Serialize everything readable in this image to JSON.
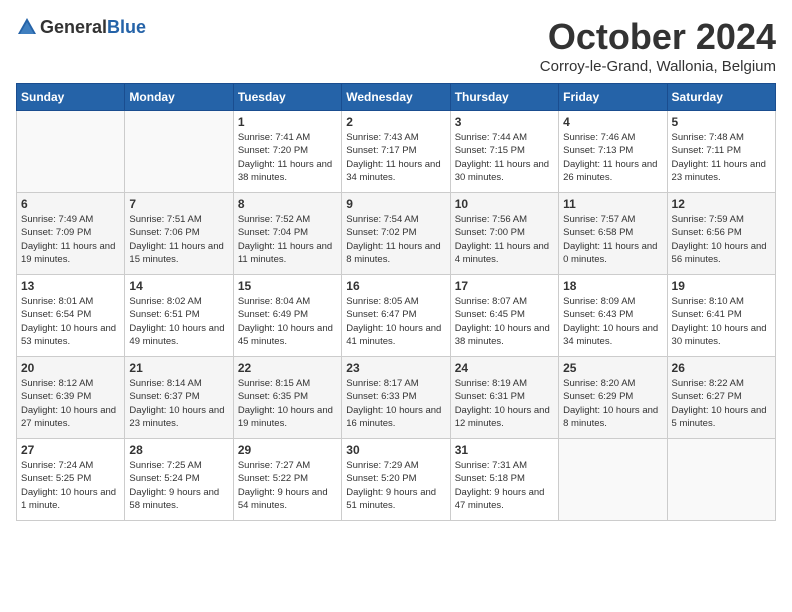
{
  "header": {
    "logo_general": "General",
    "logo_blue": "Blue",
    "month_title": "October 2024",
    "location": "Corroy-le-Grand, Wallonia, Belgium"
  },
  "days_of_week": [
    "Sunday",
    "Monday",
    "Tuesday",
    "Wednesday",
    "Thursday",
    "Friday",
    "Saturday"
  ],
  "weeks": [
    [
      {
        "day": "",
        "info": ""
      },
      {
        "day": "",
        "info": ""
      },
      {
        "day": "1",
        "info": "Sunrise: 7:41 AM\nSunset: 7:20 PM\nDaylight: 11 hours and 38 minutes."
      },
      {
        "day": "2",
        "info": "Sunrise: 7:43 AM\nSunset: 7:17 PM\nDaylight: 11 hours and 34 minutes."
      },
      {
        "day": "3",
        "info": "Sunrise: 7:44 AM\nSunset: 7:15 PM\nDaylight: 11 hours and 30 minutes."
      },
      {
        "day": "4",
        "info": "Sunrise: 7:46 AM\nSunset: 7:13 PM\nDaylight: 11 hours and 26 minutes."
      },
      {
        "day": "5",
        "info": "Sunrise: 7:48 AM\nSunset: 7:11 PM\nDaylight: 11 hours and 23 minutes."
      }
    ],
    [
      {
        "day": "6",
        "info": "Sunrise: 7:49 AM\nSunset: 7:09 PM\nDaylight: 11 hours and 19 minutes."
      },
      {
        "day": "7",
        "info": "Sunrise: 7:51 AM\nSunset: 7:06 PM\nDaylight: 11 hours and 15 minutes."
      },
      {
        "day": "8",
        "info": "Sunrise: 7:52 AM\nSunset: 7:04 PM\nDaylight: 11 hours and 11 minutes."
      },
      {
        "day": "9",
        "info": "Sunrise: 7:54 AM\nSunset: 7:02 PM\nDaylight: 11 hours and 8 minutes."
      },
      {
        "day": "10",
        "info": "Sunrise: 7:56 AM\nSunset: 7:00 PM\nDaylight: 11 hours and 4 minutes."
      },
      {
        "day": "11",
        "info": "Sunrise: 7:57 AM\nSunset: 6:58 PM\nDaylight: 11 hours and 0 minutes."
      },
      {
        "day": "12",
        "info": "Sunrise: 7:59 AM\nSunset: 6:56 PM\nDaylight: 10 hours and 56 minutes."
      }
    ],
    [
      {
        "day": "13",
        "info": "Sunrise: 8:01 AM\nSunset: 6:54 PM\nDaylight: 10 hours and 53 minutes."
      },
      {
        "day": "14",
        "info": "Sunrise: 8:02 AM\nSunset: 6:51 PM\nDaylight: 10 hours and 49 minutes."
      },
      {
        "day": "15",
        "info": "Sunrise: 8:04 AM\nSunset: 6:49 PM\nDaylight: 10 hours and 45 minutes."
      },
      {
        "day": "16",
        "info": "Sunrise: 8:05 AM\nSunset: 6:47 PM\nDaylight: 10 hours and 41 minutes."
      },
      {
        "day": "17",
        "info": "Sunrise: 8:07 AM\nSunset: 6:45 PM\nDaylight: 10 hours and 38 minutes."
      },
      {
        "day": "18",
        "info": "Sunrise: 8:09 AM\nSunset: 6:43 PM\nDaylight: 10 hours and 34 minutes."
      },
      {
        "day": "19",
        "info": "Sunrise: 8:10 AM\nSunset: 6:41 PM\nDaylight: 10 hours and 30 minutes."
      }
    ],
    [
      {
        "day": "20",
        "info": "Sunrise: 8:12 AM\nSunset: 6:39 PM\nDaylight: 10 hours and 27 minutes."
      },
      {
        "day": "21",
        "info": "Sunrise: 8:14 AM\nSunset: 6:37 PM\nDaylight: 10 hours and 23 minutes."
      },
      {
        "day": "22",
        "info": "Sunrise: 8:15 AM\nSunset: 6:35 PM\nDaylight: 10 hours and 19 minutes."
      },
      {
        "day": "23",
        "info": "Sunrise: 8:17 AM\nSunset: 6:33 PM\nDaylight: 10 hours and 16 minutes."
      },
      {
        "day": "24",
        "info": "Sunrise: 8:19 AM\nSunset: 6:31 PM\nDaylight: 10 hours and 12 minutes."
      },
      {
        "day": "25",
        "info": "Sunrise: 8:20 AM\nSunset: 6:29 PM\nDaylight: 10 hours and 8 minutes."
      },
      {
        "day": "26",
        "info": "Sunrise: 8:22 AM\nSunset: 6:27 PM\nDaylight: 10 hours and 5 minutes."
      }
    ],
    [
      {
        "day": "27",
        "info": "Sunrise: 7:24 AM\nSunset: 5:25 PM\nDaylight: 10 hours and 1 minute."
      },
      {
        "day": "28",
        "info": "Sunrise: 7:25 AM\nSunset: 5:24 PM\nDaylight: 9 hours and 58 minutes."
      },
      {
        "day": "29",
        "info": "Sunrise: 7:27 AM\nSunset: 5:22 PM\nDaylight: 9 hours and 54 minutes."
      },
      {
        "day": "30",
        "info": "Sunrise: 7:29 AM\nSunset: 5:20 PM\nDaylight: 9 hours and 51 minutes."
      },
      {
        "day": "31",
        "info": "Sunrise: 7:31 AM\nSunset: 5:18 PM\nDaylight: 9 hours and 47 minutes."
      },
      {
        "day": "",
        "info": ""
      },
      {
        "day": "",
        "info": ""
      }
    ]
  ]
}
